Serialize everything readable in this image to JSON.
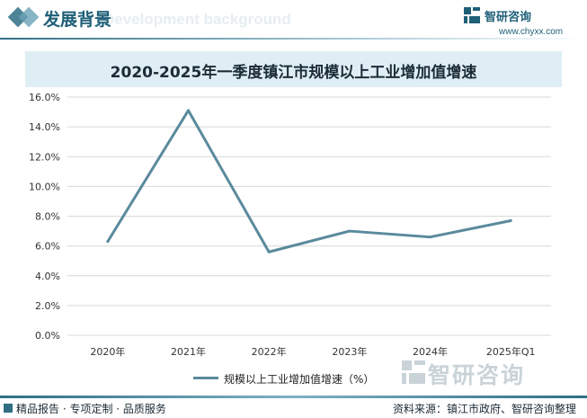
{
  "header": {
    "title": "发展背景",
    "subtitle_en": "Development background"
  },
  "brand": {
    "name": "智研咨询",
    "url": "www.chyxx.com"
  },
  "watermark": {
    "text": "智研咨询"
  },
  "footer": {
    "left": "精品报告 · 专项定制 · 品质服务",
    "right": "资料来源：镇江市政府、智研咨询整理"
  },
  "colors": {
    "accent": "#1f5f78",
    "line": "#5a8a9c",
    "title_band": "#deeef4",
    "grid": "#d9d9d9"
  },
  "chart_data": {
    "type": "line",
    "title": "2020-2025年一季度镇江市规模以上工业增加值增速",
    "categories": [
      "2020年",
      "2021年",
      "2022年",
      "2023年",
      "2024年",
      "2025年Q1"
    ],
    "series": [
      {
        "name": "规模以上工业增加值增速（%）",
        "values": [
          6.3,
          15.1,
          5.6,
          7.0,
          6.6,
          7.7
        ]
      }
    ],
    "ylim": [
      0,
      16
    ],
    "yticks": [
      0,
      2,
      4,
      6,
      8,
      10,
      12,
      14,
      16
    ],
    "ytick_labels": [
      "0.0%",
      "2.0%",
      "4.0%",
      "6.0%",
      "8.0%",
      "10.0%",
      "12.0%",
      "14.0%",
      "16.0%"
    ],
    "grid": true,
    "legend_position": "bottom"
  }
}
